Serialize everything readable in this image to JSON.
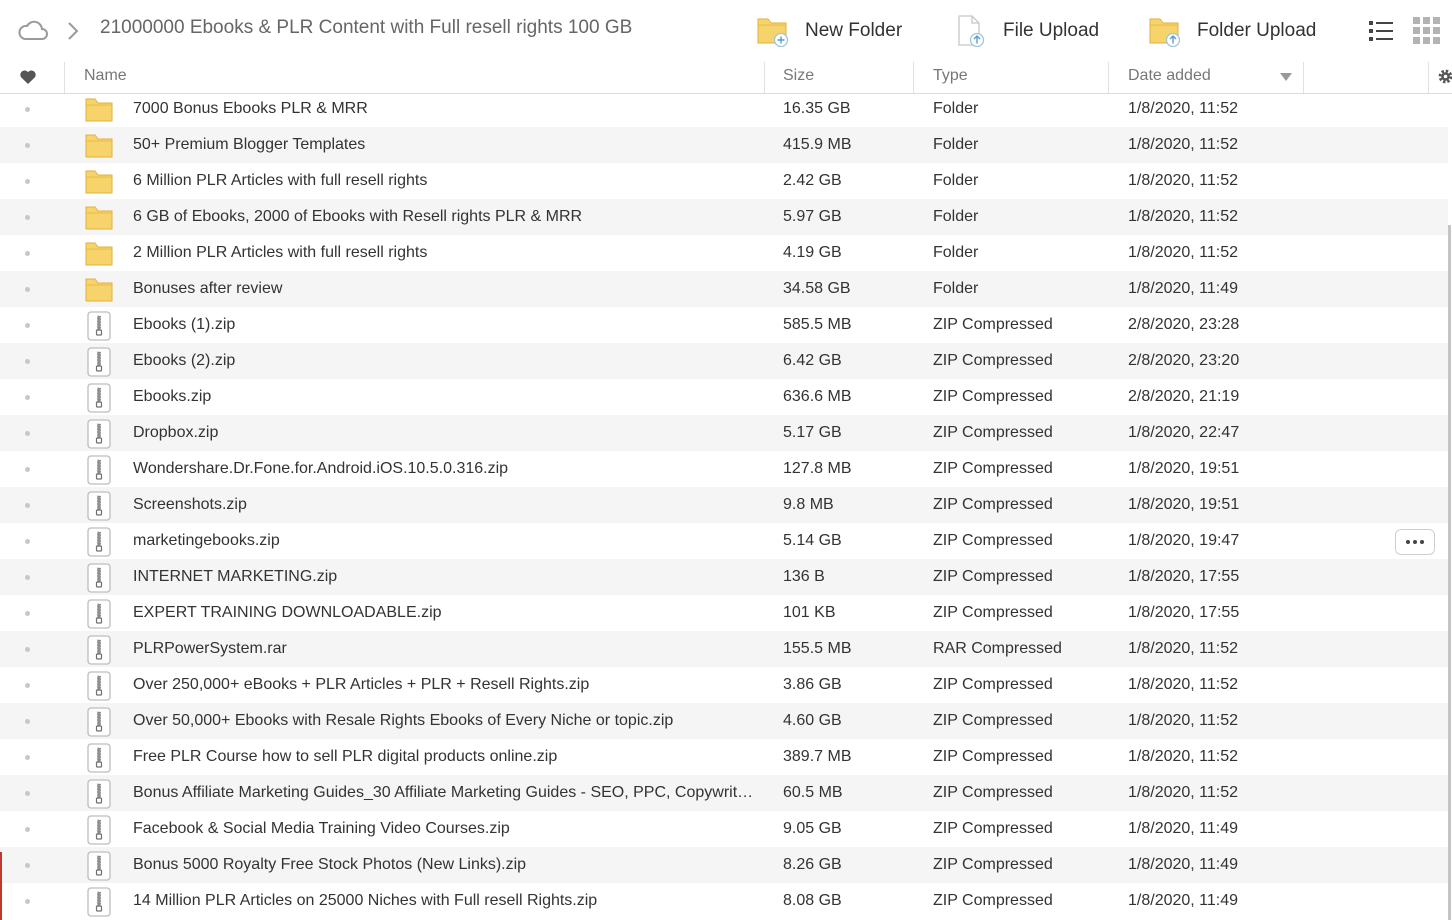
{
  "toolbar": {
    "breadcrumb": "21000000 Ebooks & PLR Content with Full resell rights 100 GB",
    "new_folder": "New Folder",
    "file_upload": "File Upload",
    "folder_upload": "Folder Upload"
  },
  "columns": {
    "name": "Name",
    "size": "Size",
    "type": "Type",
    "date": "Date added"
  },
  "colors": {
    "folder": "#f5d470",
    "folder_edge": "#e6b93c",
    "alt_row": "#f5f5f5",
    "accent": "#c0392b"
  },
  "rows": [
    {
      "kind": "folder",
      "name": "7000 Bonus Ebooks PLR & MRR",
      "size": "16.35 GB",
      "type": "Folder",
      "date": "1/8/2020, 11:52"
    },
    {
      "kind": "folder",
      "name": "50+ Premium Blogger Templates",
      "size": "415.9 MB",
      "type": "Folder",
      "date": "1/8/2020, 11:52"
    },
    {
      "kind": "folder",
      "name": "6 Million PLR Articles with full resell rights",
      "size": "2.42 GB",
      "type": "Folder",
      "date": "1/8/2020, 11:52"
    },
    {
      "kind": "folder",
      "name": "6 GB of Ebooks, 2000 of Ebooks with Resell rights PLR & MRR",
      "size": "5.97 GB",
      "type": "Folder",
      "date": "1/8/2020, 11:52"
    },
    {
      "kind": "folder",
      "name": "2 Million PLR Articles with full resell rights",
      "size": "4.19 GB",
      "type": "Folder",
      "date": "1/8/2020, 11:52"
    },
    {
      "kind": "folder",
      "name": "Bonuses after review",
      "size": "34.58 GB",
      "type": "Folder",
      "date": "1/8/2020, 11:49"
    },
    {
      "kind": "zip",
      "name": "Ebooks (1).zip",
      "size": "585.5 MB",
      "type": "ZIP Compressed",
      "date": "2/8/2020, 23:28"
    },
    {
      "kind": "zip",
      "name": "Ebooks (2).zip",
      "size": "6.42 GB",
      "type": "ZIP Compressed",
      "date": "2/8/2020, 23:20"
    },
    {
      "kind": "zip",
      "name": "Ebooks.zip",
      "size": "636.6 MB",
      "type": "ZIP Compressed",
      "date": "2/8/2020, 21:19"
    },
    {
      "kind": "zip",
      "name": "Dropbox.zip",
      "size": "5.17 GB",
      "type": "ZIP Compressed",
      "date": "1/8/2020, 22:47"
    },
    {
      "kind": "zip",
      "name": "Wondershare.Dr.Fone.for.Android.iOS.10.5.0.316.zip",
      "size": "127.8 MB",
      "type": "ZIP Compressed",
      "date": "1/8/2020, 19:51"
    },
    {
      "kind": "zip",
      "name": "Screenshots.zip",
      "size": "9.8 MB",
      "type": "ZIP Compressed",
      "date": "1/8/2020, 19:51"
    },
    {
      "kind": "zip",
      "name": "marketingebooks.zip",
      "size": "5.14 GB",
      "type": "ZIP Compressed",
      "date": "1/8/2020, 19:47",
      "hover": true
    },
    {
      "kind": "zip",
      "name": "INTERNET MARKETING.zip",
      "size": "136 B",
      "type": "ZIP Compressed",
      "date": "1/8/2020, 17:55"
    },
    {
      "kind": "zip",
      "name": "EXPERT TRAINING DOWNLOADABLE.zip",
      "size": "101 KB",
      "type": "ZIP Compressed",
      "date": "1/8/2020, 17:55"
    },
    {
      "kind": "zip",
      "name": "PLRPowerSystem.rar",
      "size": "155.5 MB",
      "type": "RAR Compressed",
      "date": "1/8/2020, 11:52"
    },
    {
      "kind": "zip",
      "name": "Over 250,000+ eBooks + PLR Articles + PLR + Resell Rights.zip",
      "size": "3.86 GB",
      "type": "ZIP Compressed",
      "date": "1/8/2020, 11:52"
    },
    {
      "kind": "zip",
      "name": "Over 50,000+ Ebooks with Resale Rights Ebooks of Every Niche or topic.zip",
      "size": "4.60 GB",
      "type": "ZIP Compressed",
      "date": "1/8/2020, 11:52"
    },
    {
      "kind": "zip",
      "name": "Free PLR Course how to sell PLR digital products online.zip",
      "size": "389.7 MB",
      "type": "ZIP Compressed",
      "date": "1/8/2020, 11:52"
    },
    {
      "kind": "zip",
      "name": "Bonus Affiliate Marketing Guides_30 Affiliate Marketing Guides - SEO, PPC, Copywrit…",
      "size": "60.5 MB",
      "type": "ZIP Compressed",
      "date": "1/8/2020, 11:52"
    },
    {
      "kind": "zip",
      "name": "Facebook & Social Media Training Video Courses.zip",
      "size": "9.05 GB",
      "type": "ZIP Compressed",
      "date": "1/8/2020, 11:49"
    },
    {
      "kind": "zip",
      "name": "Bonus 5000 Royalty Free Stock Photos (New Links).zip",
      "size": "8.26 GB",
      "type": "ZIP Compressed",
      "date": "1/8/2020, 11:49"
    },
    {
      "kind": "zip",
      "name": "14 Million PLR Articles on 25000 Niches with Full resell Rights.zip",
      "size": "8.08 GB",
      "type": "ZIP Compressed",
      "date": "1/8/2020, 11:49"
    }
  ]
}
